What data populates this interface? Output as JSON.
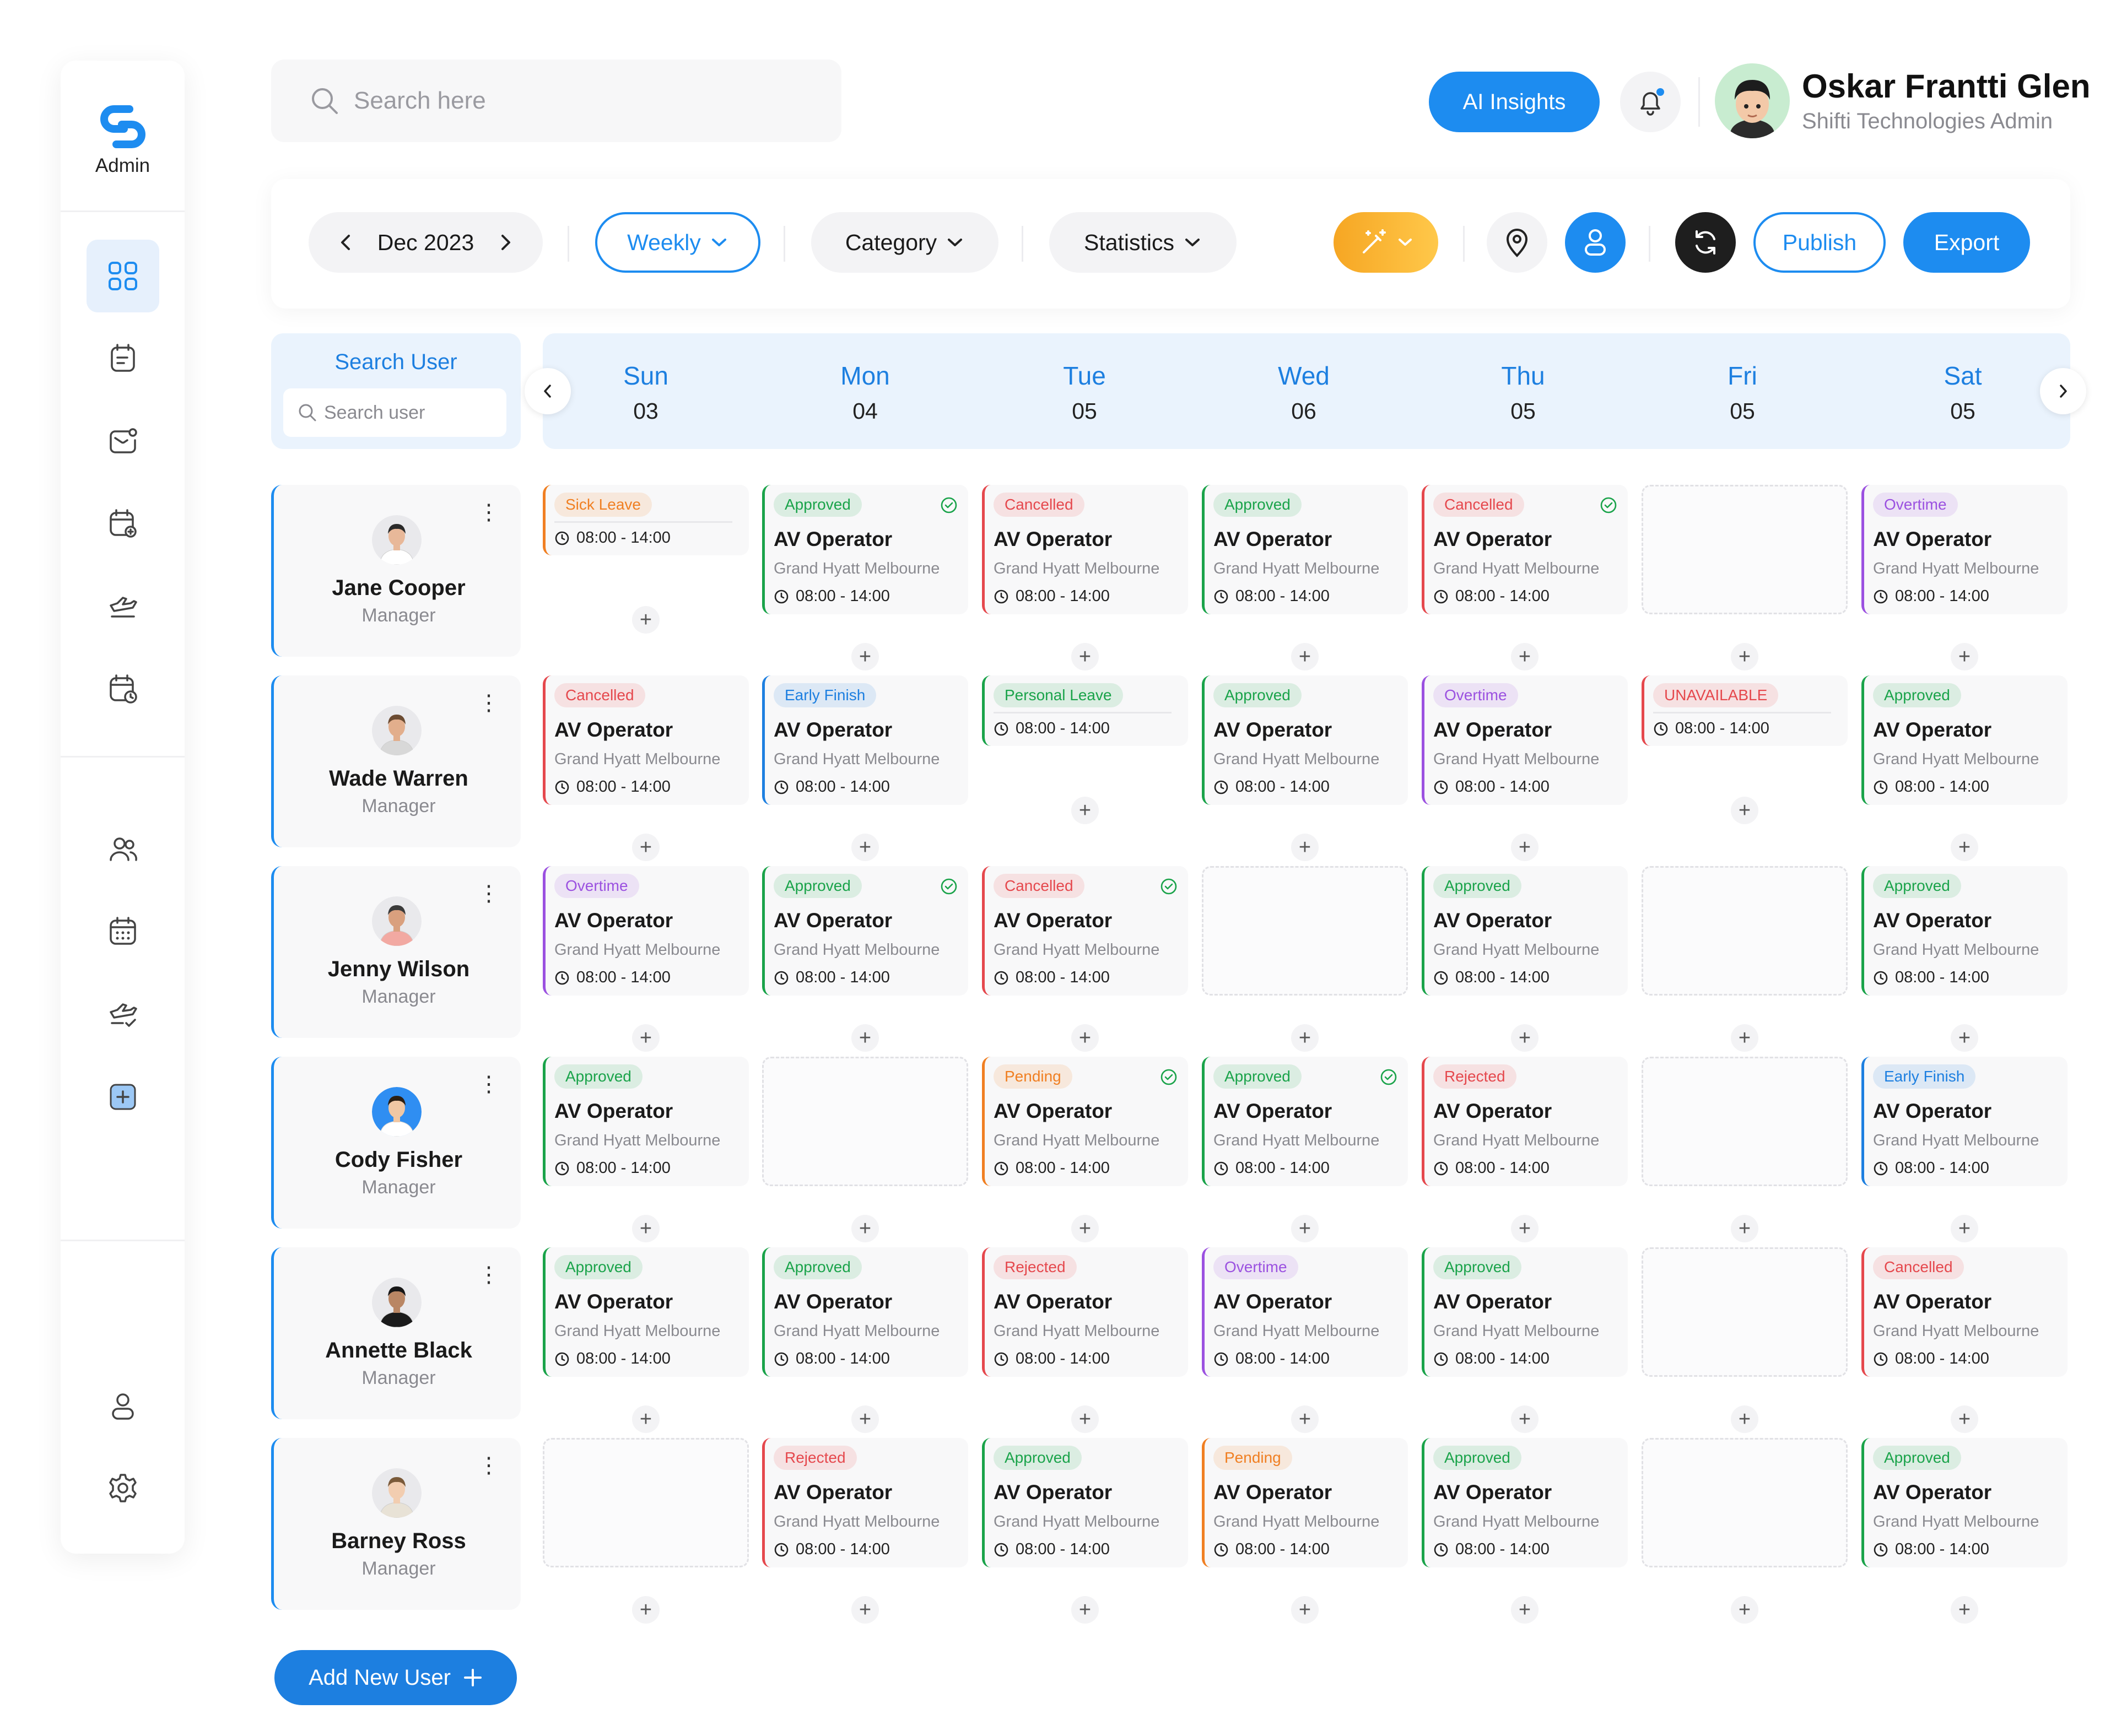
{
  "sidebar": {
    "brand_label": "Admin"
  },
  "search": {
    "placeholder": "Search here"
  },
  "header": {
    "ai_button": "AI Insights",
    "user_name": "Oskar Frantti Glen",
    "user_role": "Shifti Technologies Admin"
  },
  "toolbar": {
    "month": "Dec 2023",
    "view": "Weekly",
    "category": "Category",
    "statistics": "Statistics",
    "publish": "Publish",
    "export": "Export"
  },
  "search_user": {
    "title": "Search User",
    "placeholder": "Search user"
  },
  "days": [
    {
      "name": "Sun",
      "date": "03"
    },
    {
      "name": "Mon",
      "date": "04"
    },
    {
      "name": "Tue",
      "date": "05"
    },
    {
      "name": "Wed",
      "date": "06"
    },
    {
      "name": "Thu",
      "date": "05"
    },
    {
      "name": "Fri",
      "date": "05"
    },
    {
      "name": "Sat",
      "date": "05"
    }
  ],
  "status_colors": {
    "Approved": "#1aa34a",
    "Cancelled": "#e5484d",
    "Rejected": "#e5484d",
    "UNAVAILABLE": "#e5484d",
    "Sick Leave": "#f07f22",
    "Pending": "#f07f22",
    "Overtime": "#9b51e0",
    "Early Finish": "#1d7fe0",
    "Personal Leave": "#1aa34a"
  },
  "users": [
    {
      "name": "Jane Cooper",
      "role": "Manager",
      "shifts": [
        {
          "status": "Sick Leave",
          "short": true,
          "time": "08:00 - 14:00"
        },
        {
          "status": "Approved",
          "role": "AV Operator",
          "location": "Grand Hyatt Melbourne",
          "time": "08:00 - 14:00",
          "check": true
        },
        {
          "status": "Cancelled",
          "role": "AV Operator",
          "location": "Grand Hyatt Melbourne",
          "time": "08:00 - 14:00"
        },
        {
          "status": "Approved",
          "role": "AV Operator",
          "location": "Grand Hyatt Melbourne",
          "time": "08:00 - 14:00"
        },
        {
          "status": "Cancelled",
          "role": "AV Operator",
          "location": "Grand Hyatt Melbourne",
          "time": "08:00 - 14:00",
          "check": true
        },
        null,
        {
          "status": "Overtime",
          "role": "AV Operator",
          "location": "Grand Hyatt Melbourne",
          "time": "08:00 - 14:00"
        }
      ]
    },
    {
      "name": "Wade Warren",
      "role": "Manager",
      "shifts": [
        {
          "status": "Cancelled",
          "role": "AV Operator",
          "location": "Grand Hyatt Melbourne",
          "time": "08:00 - 14:00"
        },
        {
          "status": "Early Finish",
          "role": "AV Operator",
          "location": "Grand Hyatt Melbourne",
          "time": "08:00 - 14:00"
        },
        {
          "status": "Personal Leave",
          "short": true,
          "time": "08:00 - 14:00"
        },
        {
          "status": "Approved",
          "role": "AV Operator",
          "location": "Grand Hyatt Melbourne",
          "time": "08:00 - 14:00"
        },
        {
          "status": "Overtime",
          "role": "AV Operator",
          "location": "Grand Hyatt Melbourne",
          "time": "08:00 - 14:00"
        },
        {
          "status": "UNAVAILABLE",
          "short": true,
          "time": "08:00 - 14:00"
        },
        {
          "status": "Approved",
          "role": "AV Operator",
          "location": "Grand Hyatt Melbourne",
          "time": "08:00 - 14:00"
        }
      ]
    },
    {
      "name": "Jenny Wilson",
      "role": "Manager",
      "shifts": [
        {
          "status": "Overtime",
          "role": "AV Operator",
          "location": "Grand Hyatt Melbourne",
          "time": "08:00 - 14:00"
        },
        {
          "status": "Approved",
          "role": "AV Operator",
          "location": "Grand Hyatt Melbourne",
          "time": "08:00 - 14:00",
          "check": true
        },
        {
          "status": "Cancelled",
          "role": "AV Operator",
          "location": "Grand Hyatt Melbourne",
          "time": "08:00 - 14:00",
          "check": true
        },
        null,
        {
          "status": "Approved",
          "role": "AV Operator",
          "location": "Grand Hyatt Melbourne",
          "time": "08:00 - 14:00"
        },
        null,
        {
          "status": "Approved",
          "role": "AV Operator",
          "location": "Grand Hyatt Melbourne",
          "time": "08:00 - 14:00"
        }
      ]
    },
    {
      "name": "Cody Fisher",
      "role": "Manager",
      "shifts": [
        {
          "status": "Approved",
          "role": "AV Operator",
          "location": "Grand Hyatt Melbourne",
          "time": "08:00 - 14:00"
        },
        null,
        {
          "status": "Pending",
          "role": "AV Operator",
          "location": "Grand Hyatt Melbourne",
          "time": "08:00 - 14:00",
          "check": true
        },
        {
          "status": "Approved",
          "role": "AV Operator",
          "location": "Grand Hyatt Melbourne",
          "time": "08:00 - 14:00",
          "check": true
        },
        {
          "status": "Rejected",
          "role": "AV Operator",
          "location": "Grand Hyatt Melbourne",
          "time": "08:00 - 14:00"
        },
        null,
        {
          "status": "Early Finish",
          "role": "AV Operator",
          "location": "Grand Hyatt Melbourne",
          "time": "08:00 - 14:00"
        }
      ]
    },
    {
      "name": "Annette Black",
      "role": "Manager",
      "shifts": [
        {
          "status": "Approved",
          "role": "AV Operator",
          "location": "Grand Hyatt Melbourne",
          "time": "08:00 - 14:00"
        },
        {
          "status": "Approved",
          "role": "AV Operator",
          "location": "Grand Hyatt Melbourne",
          "time": "08:00 - 14:00"
        },
        {
          "status": "Rejected",
          "role": "AV Operator",
          "location": "Grand Hyatt Melbourne",
          "time": "08:00 - 14:00"
        },
        {
          "status": "Overtime",
          "role": "AV Operator",
          "location": "Grand Hyatt Melbourne",
          "time": "08:00 - 14:00"
        },
        {
          "status": "Approved",
          "role": "AV Operator",
          "location": "Grand Hyatt Melbourne",
          "time": "08:00 - 14:00"
        },
        null,
        {
          "status": "Cancelled",
          "role": "AV Operator",
          "location": "Grand Hyatt Melbourne",
          "time": "08:00 - 14:00"
        }
      ]
    },
    {
      "name": "Barney Ross",
      "role": "Manager",
      "shifts": [
        null,
        {
          "status": "Rejected",
          "role": "AV Operator",
          "location": "Grand Hyatt Melbourne",
          "time": "08:00 - 14:00"
        },
        {
          "status": "Approved",
          "role": "AV Operator",
          "location": "Grand Hyatt Melbourne",
          "time": "08:00 - 14:00"
        },
        {
          "status": "Pending",
          "role": "AV Operator",
          "location": "Grand Hyatt Melbourne",
          "time": "08:00 - 14:00"
        },
        {
          "status": "Approved",
          "role": "AV Operator",
          "location": "Grand Hyatt Melbourne",
          "time": "08:00 - 14:00"
        },
        null,
        {
          "status": "Approved",
          "role": "AV Operator",
          "location": "Grand Hyatt Melbourne",
          "time": "08:00 - 14:00"
        }
      ]
    }
  ],
  "add_user_button": "Add New User"
}
